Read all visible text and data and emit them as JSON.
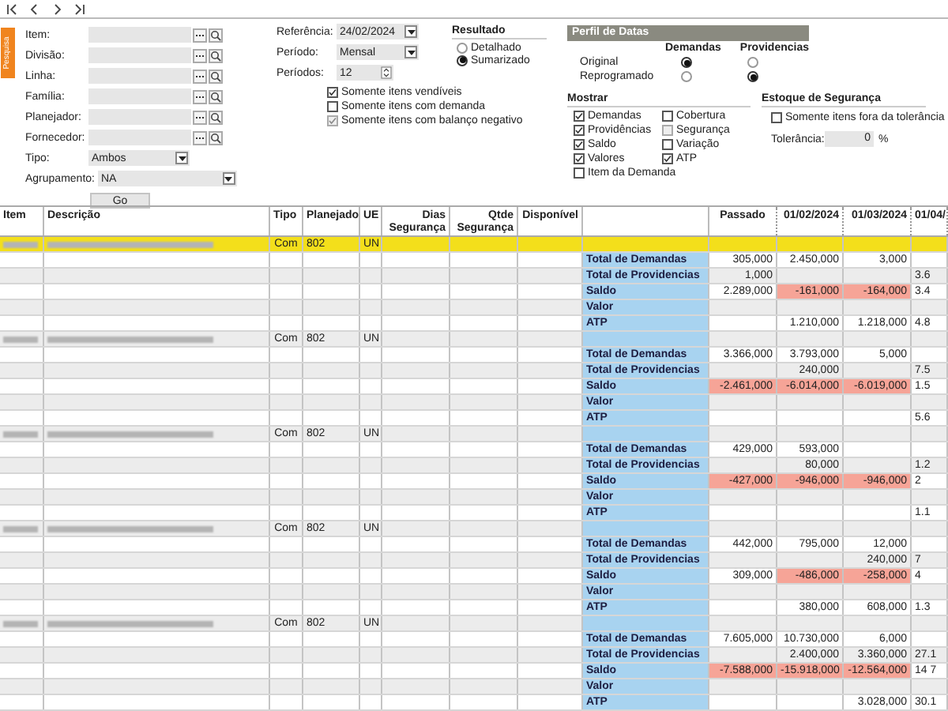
{
  "side_tab": "Pesquisa",
  "filters": [
    {
      "label": "Item:",
      "kind": "lookup"
    },
    {
      "label": "Divisão:",
      "kind": "lookup"
    },
    {
      "label": "Linha:",
      "kind": "lookup"
    },
    {
      "label": "Família:",
      "kind": "lookup"
    },
    {
      "label": "Planejador:",
      "kind": "lookup"
    },
    {
      "label": "Fornecedor:",
      "kind": "lookup"
    },
    {
      "label": "Tipo:",
      "kind": "select",
      "value": "Ambos"
    },
    {
      "label": "Agrupamento:",
      "kind": "select_wide",
      "value": "NA"
    }
  ],
  "go_button": "Go",
  "parameters": [
    {
      "label": "Referência:",
      "kind": "date",
      "value": "24/02/2024"
    },
    {
      "label": "Período:",
      "kind": "select",
      "value": "Mensal"
    },
    {
      "label": "Períodos:",
      "kind": "spin",
      "value": "12"
    }
  ],
  "options": [
    {
      "label": "Somente itens vendíveis",
      "checked": true,
      "disabled": false
    },
    {
      "label": "Somente itens com demanda",
      "checked": false,
      "disabled": false
    },
    {
      "label": "Somente itens com balanço negativo",
      "checked": true,
      "disabled": true
    }
  ],
  "resultado": {
    "title": "Resultado",
    "options": [
      {
        "label": "Detalhado",
        "selected": false
      },
      {
        "label": "Sumarizado",
        "selected": true
      }
    ]
  },
  "perfil": {
    "title": "Perfil de Datas",
    "columns": [
      "Demandas",
      "Providencias"
    ],
    "rows": [
      {
        "label": "Original",
        "options": [
          {
            "selected": true
          },
          {
            "selected": false
          }
        ]
      },
      {
        "label": "Reprogramado",
        "options": [
          {
            "selected": false
          },
          {
            "selected": true
          }
        ]
      }
    ]
  },
  "mostrar": {
    "title": "Mostrar",
    "columns": [
      [
        {
          "label": "Demandas",
          "checked": true,
          "disabled": false
        },
        {
          "label": "Providências",
          "checked": true,
          "disabled": false
        },
        {
          "label": "Saldo",
          "checked": true,
          "disabled": false
        },
        {
          "label": "Valores",
          "checked": true,
          "disabled": false
        },
        {
          "label": "Item da Demanda",
          "checked": false,
          "disabled": false
        }
      ],
      [
        {
          "label": "Cobertura",
          "checked": false,
          "disabled": false
        },
        {
          "label": "Segurança",
          "checked": false,
          "disabled": true
        },
        {
          "label": "Variação",
          "checked": false,
          "disabled": false
        },
        {
          "label": "ATP",
          "checked": true,
          "disabled": false
        }
      ]
    ]
  },
  "estoque": {
    "title": "Estoque de Segurança",
    "option": {
      "label": "Somente itens fora da tolerância",
      "checked": false
    },
    "tolerance_label": "Tolerância:",
    "tolerance_value": "0",
    "unit": "%"
  },
  "grid": {
    "columns": [
      "Item",
      "Descrição",
      "Tipo",
      "Planejado",
      "UE",
      "Dias Segurança",
      "Qtde Segurança",
      "Disponível"
    ],
    "period_columns": [
      "Passado",
      "01/02/2024",
      "01/03/2024",
      "01/04/"
    ],
    "rows": [
      {
        "kind": "item",
        "selected": true,
        "tipo": "Com",
        "planejado": "802",
        "ue": "UN"
      },
      {
        "kind": "measure",
        "label": "Total de Demandas",
        "cells": {
          "passado": {
            "text": "305,000",
            "alert": false
          },
          "p1": {
            "text": "2.450,000",
            "alert": false
          },
          "p2": {
            "text": "3,000",
            "alert": false
          }
        }
      },
      {
        "kind": "measure",
        "label": "Total de Providencias",
        "cells": {
          "passado": {
            "text": "1,000",
            "alert": false
          },
          "p3": {
            "text": "3.6",
            "alert": false
          }
        }
      },
      {
        "kind": "measure",
        "label": "Saldo",
        "cells": {
          "passado": {
            "text": "2.289,000",
            "alert": false
          },
          "p1": {
            "text": "-161,000",
            "alert": true
          },
          "p2": {
            "text": "-164,000",
            "alert": true
          },
          "p3": {
            "text": "3.4",
            "alert": false
          }
        }
      },
      {
        "kind": "measure",
        "label": "Valor"
      },
      {
        "kind": "measure",
        "label": "ATP",
        "cells": {
          "p1": {
            "text": "1.210,000",
            "alert": false
          },
          "p2": {
            "text": "1.218,000",
            "alert": false
          },
          "p3": {
            "text": "4.8",
            "alert": false
          }
        }
      },
      {
        "kind": "item",
        "selected": false,
        "tipo": "Com",
        "planejado": "802",
        "ue": "UN"
      },
      {
        "kind": "measure",
        "label": "Total de Demandas",
        "cells": {
          "passado": {
            "text": "3.366,000",
            "alert": false
          },
          "p1": {
            "text": "3.793,000",
            "alert": false
          },
          "p2": {
            "text": "5,000",
            "alert": false
          }
        }
      },
      {
        "kind": "measure",
        "label": "Total de Providencias",
        "cells": {
          "p1": {
            "text": "240,000",
            "alert": false
          },
          "p3": {
            "text": "7.5",
            "alert": false
          }
        }
      },
      {
        "kind": "measure",
        "label": "Saldo",
        "cells": {
          "passado": {
            "text": "-2.461,000",
            "alert": true
          },
          "p1": {
            "text": "-6.014,000",
            "alert": true
          },
          "p2": {
            "text": "-6.019,000",
            "alert": true
          },
          "p3": {
            "text": "1.5",
            "alert": false
          }
        }
      },
      {
        "kind": "measure",
        "label": "Valor"
      },
      {
        "kind": "measure",
        "label": "ATP",
        "cells": {
          "p3": {
            "text": "5.6",
            "alert": false
          }
        }
      },
      {
        "kind": "item",
        "selected": false,
        "tipo": "Com",
        "planejado": "802",
        "ue": "UN"
      },
      {
        "kind": "measure",
        "label": "Total de Demandas",
        "cells": {
          "passado": {
            "text": "429,000",
            "alert": false
          },
          "p1": {
            "text": "593,000",
            "alert": false
          }
        }
      },
      {
        "kind": "measure",
        "label": "Total de Providencias",
        "cells": {
          "p1": {
            "text": "80,000",
            "alert": false
          },
          "p3": {
            "text": "1.2",
            "alert": false
          }
        }
      },
      {
        "kind": "measure",
        "label": "Saldo",
        "cells": {
          "passado": {
            "text": "-427,000",
            "alert": true
          },
          "p1": {
            "text": "-946,000",
            "alert": true
          },
          "p2": {
            "text": "-946,000",
            "alert": true
          },
          "p3": {
            "text": "2",
            "alert": false
          }
        }
      },
      {
        "kind": "measure",
        "label": "Valor"
      },
      {
        "kind": "measure",
        "label": "ATP",
        "cells": {
          "p3": {
            "text": "1.1",
            "alert": false
          }
        }
      },
      {
        "kind": "item",
        "selected": false,
        "tipo": "Com",
        "planejado": "802",
        "ue": "UN"
      },
      {
        "kind": "measure",
        "label": "Total de Demandas",
        "cells": {
          "passado": {
            "text": "442,000",
            "alert": false
          },
          "p1": {
            "text": "795,000",
            "alert": false
          },
          "p2": {
            "text": "12,000",
            "alert": false
          }
        }
      },
      {
        "kind": "measure",
        "label": "Total de Providencias",
        "cells": {
          "p2": {
            "text": "240,000",
            "alert": false
          },
          "p3": {
            "text": "7",
            "alert": false
          }
        }
      },
      {
        "kind": "measure",
        "label": "Saldo",
        "cells": {
          "passado": {
            "text": "309,000",
            "alert": false
          },
          "p1": {
            "text": "-486,000",
            "alert": true
          },
          "p2": {
            "text": "-258,000",
            "alert": true
          },
          "p3": {
            "text": "4",
            "alert": false
          }
        }
      },
      {
        "kind": "measure",
        "label": "Valor"
      },
      {
        "kind": "measure",
        "label": "ATP",
        "cells": {
          "p1": {
            "text": "380,000",
            "alert": false
          },
          "p2": {
            "text": "608,000",
            "alert": false
          },
          "p3": {
            "text": "1.3",
            "alert": false
          }
        }
      },
      {
        "kind": "item",
        "selected": false,
        "tipo": "Com",
        "planejado": "802",
        "ue": "UN"
      },
      {
        "kind": "measure",
        "label": "Total de Demandas",
        "cells": {
          "passado": {
            "text": "7.605,000",
            "alert": false
          },
          "p1": {
            "text": "10.730,000",
            "alert": false
          },
          "p2": {
            "text": "6,000",
            "alert": false
          }
        }
      },
      {
        "kind": "measure",
        "label": "Total de Providencias",
        "cells": {
          "p1": {
            "text": "2.400,000",
            "alert": false
          },
          "p2": {
            "text": "3.360,000",
            "alert": false
          },
          "p3": {
            "text": "27.1",
            "alert": false
          }
        }
      },
      {
        "kind": "measure",
        "label": "Saldo",
        "cells": {
          "passado": {
            "text": "-7.588,000",
            "alert": true
          },
          "p1": {
            "text": "-15.918,000",
            "alert": true
          },
          "p2": {
            "text": "-12.564,000",
            "alert": true
          },
          "p3": {
            "text": "14 7",
            "alert": false
          }
        }
      },
      {
        "kind": "measure",
        "label": "Valor"
      },
      {
        "kind": "measure",
        "label": "ATP",
        "cells": {
          "p2": {
            "text": "3.028,000",
            "alert": false
          },
          "p3": {
            "text": "30.1",
            "alert": false
          }
        }
      }
    ]
  }
}
